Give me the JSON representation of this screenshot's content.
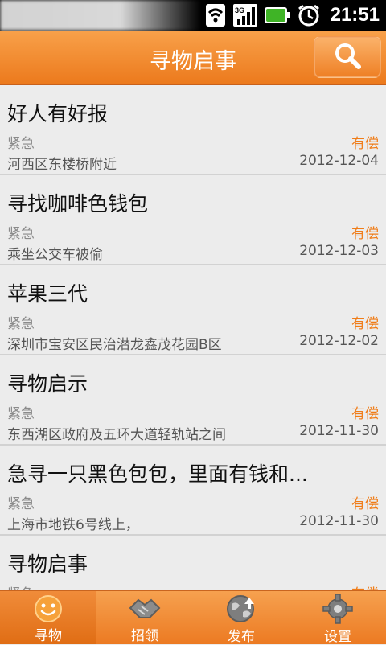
{
  "status_bar": {
    "time": "21:51",
    "icons": [
      "wifi-icon",
      "signal-icon",
      "battery-icon",
      "alarm-icon"
    ]
  },
  "header": {
    "title": "寻物启事",
    "search_icon": "search-icon"
  },
  "colors": {
    "accent": "#ec7a1d",
    "reward": "#f07c17",
    "urgent": "#8a8a8a"
  },
  "items": [
    {
      "title": "好人有好报",
      "urgency": "紧急",
      "reward": "有偿",
      "location": "河西区东楼桥附近",
      "date": "2012-12-04"
    },
    {
      "title": "寻找咖啡色钱包",
      "urgency": "紧急",
      "reward": "有偿",
      "location": "乘坐公交车被偷",
      "date": "2012-12-03"
    },
    {
      "title": "苹果三代",
      "urgency": "紧急",
      "reward": "有偿",
      "location": "深圳市宝安区民治潜龙鑫茂花园B区",
      "date": "2012-12-02"
    },
    {
      "title": "寻物启示",
      "urgency": "紧急",
      "reward": "有偿",
      "location": "东西湖区政府及五环大道轻轨站之间",
      "date": "2012-11-30"
    },
    {
      "title": "急寻一只黑色包包，里面有钱和...",
      "urgency": "紧急",
      "reward": "有偿",
      "location": "上海市地铁6号线上，",
      "date": "2012-11-30"
    },
    {
      "title": "寻物启事",
      "urgency": "紧急",
      "reward": "有偿",
      "location": "",
      "date": ""
    }
  ],
  "tabs": [
    {
      "label": "寻物",
      "icon": "smiley-icon",
      "active": true
    },
    {
      "label": "招领",
      "icon": "handshake-icon",
      "active": false
    },
    {
      "label": "发布",
      "icon": "globe-upload-icon",
      "active": false
    },
    {
      "label": "设置",
      "icon": "gear-icon",
      "active": false
    }
  ]
}
